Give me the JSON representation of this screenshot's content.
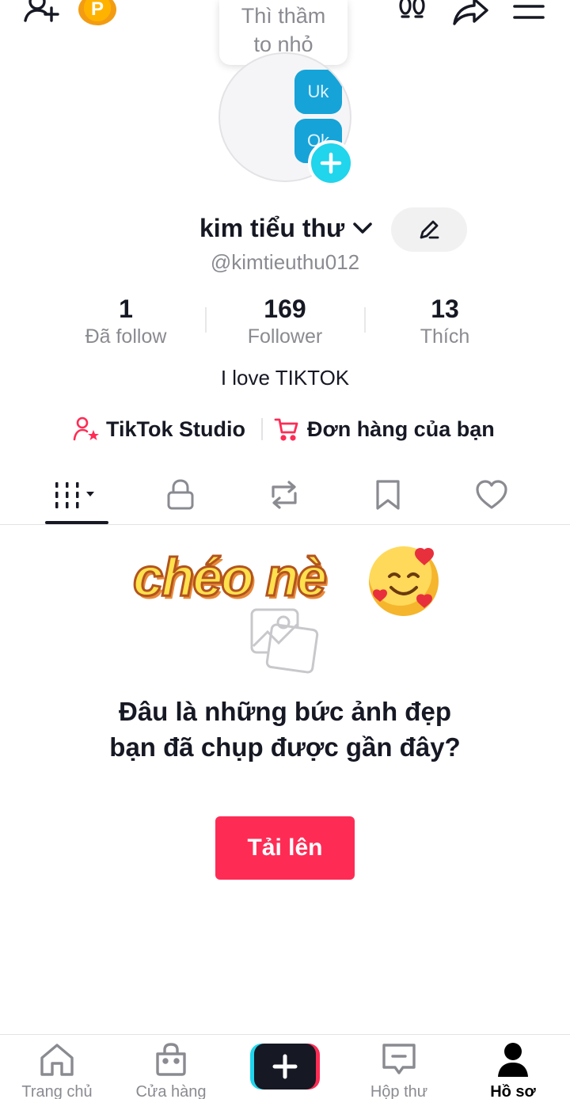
{
  "header": {
    "coin_letter": "P",
    "note": [
      "Thì thầm",
      "to nhỏ"
    ]
  },
  "avatar": {
    "stickers": [
      "Uk",
      "Ok"
    ]
  },
  "profile": {
    "name": "kim tiểu thư",
    "username": "@kimtieuthu012",
    "bio": "I love TIKTOK"
  },
  "stats": [
    {
      "value": "1",
      "label": "Đã follow"
    },
    {
      "value": "169",
      "label": "Follower"
    },
    {
      "value": "13",
      "label": "Thích"
    }
  ],
  "quick_links": {
    "studio": "TikTok Studio",
    "orders": "Đơn hàng của bạn"
  },
  "tabs": [
    "videos-grid-icon",
    "lock-icon",
    "repost-icon",
    "bookmark-icon",
    "heart-icon"
  ],
  "sticker_overlay": "chéo nè",
  "empty_state": {
    "title": "Đâu là những bức ảnh đẹp bạn đã chụp được gần đây?",
    "upload_label": "Tải lên"
  },
  "bottom_nav": [
    {
      "label": "Trang chủ",
      "icon": "home-icon"
    },
    {
      "label": "Cửa hàng",
      "icon": "shop-bag-icon"
    },
    {
      "label": "",
      "icon": "create-plus-icon"
    },
    {
      "label": "Hộp thư",
      "icon": "inbox-icon"
    },
    {
      "label": "Hồ sơ",
      "icon": "profile-icon",
      "active": true
    }
  ],
  "colors": {
    "accent": "#fe2c55",
    "cyan": "#20d5ec",
    "text_primary": "#161823",
    "text_secondary": "#8a8b91"
  }
}
